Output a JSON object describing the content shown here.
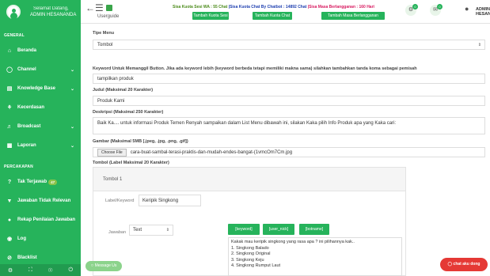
{
  "sidebar": {
    "greeting": "Selamat Datang,",
    "username": "ADMIN HESANANDA",
    "section_general": "GENERAL",
    "section_percakapan": "PERCAKAPAN",
    "items": [
      {
        "label": "Beranda",
        "icon": "home-icon"
      },
      {
        "label": "Channel",
        "icon": "channel-icon"
      },
      {
        "label": "Knowledge Base",
        "icon": "book-icon"
      },
      {
        "label": "Kecerdasan",
        "icon": "brain-icon"
      },
      {
        "label": "Broadcast",
        "icon": "broadcast-icon"
      },
      {
        "label": "Laporan",
        "icon": "chart-icon"
      }
    ],
    "chat_items": [
      {
        "label": "Tak Terjawab",
        "badge": "47",
        "icon": "question-icon"
      },
      {
        "label": "Jawaban Tidak Relevan",
        "icon": "thumbs-down-icon"
      },
      {
        "label": "Rekap Penilaian Jawaban",
        "icon": "dot-icon"
      },
      {
        "label": "Log",
        "icon": "log-icon"
      },
      {
        "label": "Blacklist",
        "icon": "blacklist-icon"
      }
    ]
  },
  "topbar": {
    "role": "Userguide",
    "info_green": "Sisa Kuota Sesi WA : 55 Chat",
    "info_blue": "|Sisa Kuota Chat By Chatbot : 14892 Chat",
    "info_red": "|Sisa Masa Berlangganan : 160 Hari",
    "btn_sesi": "Tambah Kuota Sesi",
    "btn_chat": "Tambah Kuota Chat",
    "btn_masa": "Tambah Masa Berlangganan",
    "notif1": "0",
    "notif2": "0",
    "user": "ADMIN HESANANDA"
  },
  "form": {
    "tipe_menu_label": "Tipe Menu",
    "tipe_menu_value": "Tombol",
    "keyword_label": "Keyword Untuk Memanggil Button. Jika ada keyword lebih (keyword berbeda tetapi memiliki makna sama) silahkan tambahkan tanda koma sebagai pemisah",
    "keyword_value": "tampilkan produk",
    "judul_label": "Judul (Maksimal 20 Karakter)",
    "judul_value": "Produk Kami",
    "deskripsi_label": "Deskripsi (Maksimal 250 Karakter)",
    "deskripsi_value": "Baik Ka.... untuk informasi Produk Temen Renyah sampaikan dalam List Menu dibawah ini, silakan Kaka pilih Info Produk apa yang Kaka cari:",
    "gambar_label": "Gambar (Maksimal 5MB [.jpeg, .jpg, .png, .gif])",
    "file_btn": "Choose File",
    "file_name": "cara-buat-sambal-terasi-praktis-dan-mudah-endes-bangat-(1vmcOm7Cm.jpg",
    "tombol_label": "Tombol (Label Maksimal 20 Karakter)"
  },
  "tombol1": {
    "title": "Tombol 1",
    "label_keyword_label": "Label/Keyword",
    "label_keyword_value": "Keripik Singkong",
    "jawaban_label": "Jawaban",
    "jawaban_type": "Text",
    "btn_keyword": "[keyword]",
    "btn_usernick": "[user_nick]",
    "btn_botname": "[botname]",
    "answer_lines": [
      "Kakak mau keripik singkong yang rasa apa ? ini pilihannya kak..",
      "1. Singkong Balado",
      "2. Singkong Original",
      "3. Singkong Keju",
      "4. Singkong Rumput Laut"
    ]
  },
  "floating": {
    "message_us": "Message Us",
    "chat_button": "chat aku dong"
  }
}
